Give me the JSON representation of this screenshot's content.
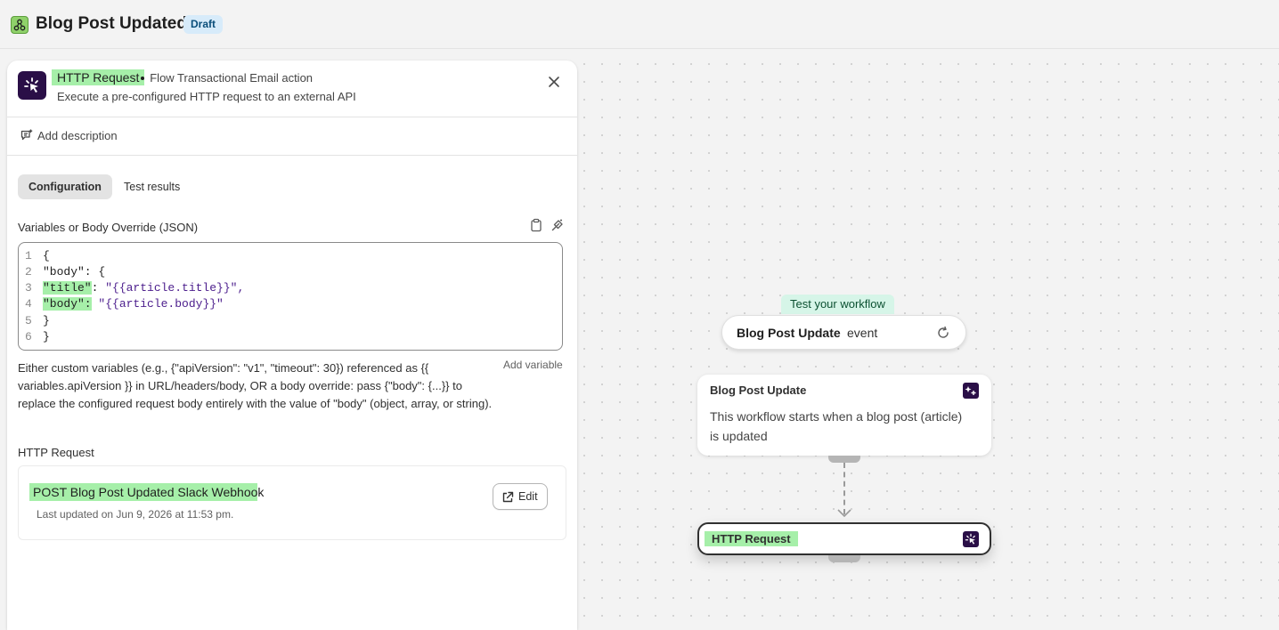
{
  "header": {
    "title": "Blog Post Updated",
    "status_badge": "Draft",
    "icon": "workflow-icon"
  },
  "panel": {
    "action_icon": "http-request-icon",
    "action_name": "HTTP Request",
    "action_subtitle": "Flow Transactional Email action",
    "action_description": "Execute a pre-configured HTTP request to an external API",
    "add_description_label": "Add description",
    "tabs": [
      {
        "label": "Configuration",
        "active": true
      },
      {
        "label": "Test results",
        "active": false
      }
    ],
    "field_label": "Variables or Body Override (JSON)",
    "code_lines": [
      {
        "num": "1",
        "text": "{"
      },
      {
        "num": "2",
        "text": "\"body\": {"
      },
      {
        "num": "3",
        "key": "\"title\"",
        "sep": ": ",
        "value": "\"{{article.title}}\","
      },
      {
        "num": "4",
        "key": "\"body\":",
        "sep": " ",
        "value": "\"{{article.body}}\""
      },
      {
        "num": "5",
        "text": "}"
      },
      {
        "num": "6",
        "text": "}"
      }
    ],
    "add_variable_label": "Add variable",
    "help_text": "Either custom variables (e.g., {\"apiVersion\": \"v1\", \"timeout\": 30}) referenced as {{ variables.apiVersion }} in URL/headers/body, OR a body override: pass {\"body\": {...}} to replace the configured request body entirely with the value of \"body\" (object, array, or string).",
    "request_section_label": "HTTP Request",
    "request": {
      "name_highlighted": "POST Blog Post Updated Slack Webhoo",
      "name_rest": "k",
      "updated": "Last updated on Jun 9, 2026 at 11:53 pm.",
      "edit_label": "Edit"
    }
  },
  "flow": {
    "test_label": "Test your workflow",
    "trigger_name": "Blog Post Update",
    "trigger_suffix": "event",
    "node1_title": "Blog Post Update",
    "node1_body": "This workflow starts when a blog post (article) is updated",
    "node2_title": "HTTP Request"
  }
}
